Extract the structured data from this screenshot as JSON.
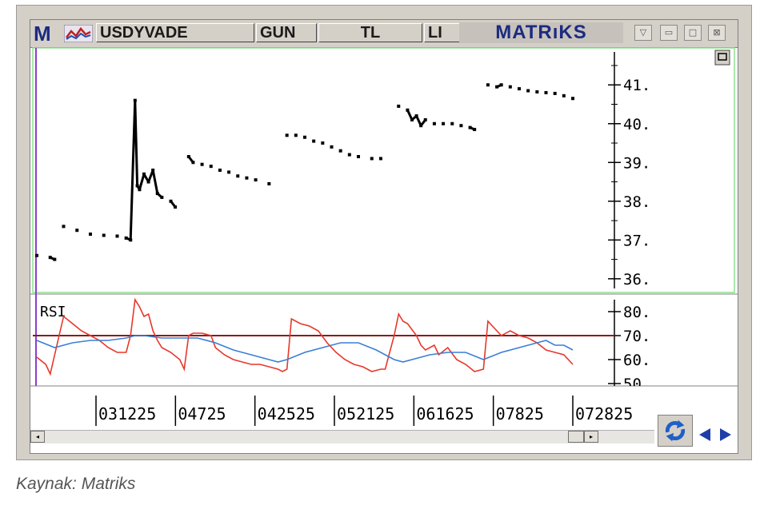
{
  "window": {
    "logo_letter": "M",
    "tabs": [
      "USDYVADE",
      "GUN",
      "TL",
      "LI"
    ],
    "brand": "MATRıKS",
    "controls": [
      "dropdown-icon",
      "minimize-icon",
      "maximize-icon",
      "close-icon"
    ]
  },
  "caption": "Kaynak: Matriks",
  "colors": {
    "price": "#000000",
    "rsi_red": "#e8372a",
    "rsi_blue": "#3a7fd5",
    "rsi_level": "#8b1a1a",
    "panel_border": "#90e090",
    "cursor_line": "#8a3fd0"
  },
  "chart_data": [
    {
      "type": "line",
      "title": "",
      "yticks": [
        "36.",
        "37.",
        "38.",
        "39.",
        "40.",
        "41."
      ],
      "ylim": [
        35.75,
        41.85
      ],
      "xlabels": [
        "031225",
        "04725",
        "042525",
        "052125",
        "061625",
        "07825",
        "072825"
      ],
      "series": [
        {
          "values": [
            [
              0,
              36.6
            ],
            [
              3,
              36.55
            ],
            [
              4,
              36.5
            ],
            [
              6,
              37.35
            ],
            [
              9,
              37.25
            ],
            [
              12,
              37.15
            ],
            [
              15,
              37.12
            ],
            [
              18,
              37.1
            ],
            [
              20,
              37.05
            ],
            [
              21,
              37.0
            ],
            [
              22,
              40.6
            ],
            [
              22.5,
              38.4
            ],
            [
              23,
              38.3
            ],
            [
              24,
              38.7
            ],
            [
              25,
              38.5
            ],
            [
              26,
              38.8
            ],
            [
              27,
              38.2
            ],
            [
              28,
              38.1
            ],
            [
              30,
              38.0
            ],
            [
              31,
              37.85
            ],
            [
              34,
              39.15
            ],
            [
              35,
              39.0
            ],
            [
              37,
              38.95
            ],
            [
              39,
              38.9
            ],
            [
              41,
              38.8
            ],
            [
              43,
              38.75
            ],
            [
              45,
              38.65
            ],
            [
              47,
              38.6
            ],
            [
              49,
              38.55
            ],
            [
              52,
              38.45
            ],
            [
              56,
              39.7
            ],
            [
              58,
              39.7
            ],
            [
              60,
              39.65
            ],
            [
              62,
              39.55
            ],
            [
              64,
              39.5
            ],
            [
              66,
              39.4
            ],
            [
              68,
              39.3
            ],
            [
              70,
              39.2
            ],
            [
              72,
              39.15
            ],
            [
              75,
              39.1
            ],
            [
              77,
              39.1
            ],
            [
              81,
              40.45
            ],
            [
              83,
              40.35
            ],
            [
              84,
              40.1
            ],
            [
              85,
              40.2
            ],
            [
              86,
              39.95
            ],
            [
              87,
              40.1
            ],
            [
              89,
              40.0
            ],
            [
              91,
              40.0
            ],
            [
              93,
              40.0
            ],
            [
              95,
              39.95
            ],
            [
              97,
              39.9
            ],
            [
              98,
              39.85
            ],
            [
              101,
              41.0
            ],
            [
              103,
              40.95
            ],
            [
              104,
              41.0
            ],
            [
              106,
              40.95
            ],
            [
              108,
              40.9
            ],
            [
              110,
              40.85
            ],
            [
              112,
              40.82
            ],
            [
              114,
              40.8
            ],
            [
              116,
              40.78
            ],
            [
              118,
              40.72
            ],
            [
              120,
              40.65
            ]
          ]
        }
      ]
    },
    {
      "type": "line",
      "title": "RSI",
      "yticks": [
        "50",
        "60.",
        "70.",
        "80."
      ],
      "ylim": [
        49,
        85
      ],
      "hline": 70,
      "series": [
        {
          "color": "red",
          "values": [
            [
              0,
              61
            ],
            [
              2,
              58
            ],
            [
              3,
              54
            ],
            [
              5,
              70
            ],
            [
              6,
              78
            ],
            [
              8,
              75
            ],
            [
              10,
              72
            ],
            [
              12,
              70
            ],
            [
              14,
              68
            ],
            [
              16,
              65
            ],
            [
              18,
              63
            ],
            [
              20,
              63
            ],
            [
              21,
              70
            ],
            [
              22,
              85
            ],
            [
              23,
              82
            ],
            [
              24,
              78
            ],
            [
              25,
              79
            ],
            [
              26,
              72
            ],
            [
              27,
              68
            ],
            [
              28,
              65
            ],
            [
              30,
              63
            ],
            [
              32,
              60
            ],
            [
              33,
              56
            ],
            [
              34,
              70
            ],
            [
              35,
              71
            ],
            [
              37,
              71
            ],
            [
              39,
              70
            ],
            [
              40,
              65
            ],
            [
              42,
              62
            ],
            [
              44,
              60
            ],
            [
              46,
              59
            ],
            [
              48,
              58
            ],
            [
              50,
              58
            ],
            [
              52,
              57
            ],
            [
              54,
              56
            ],
            [
              55,
              55
            ],
            [
              56,
              56
            ],
            [
              57,
              77
            ],
            [
              59,
              75
            ],
            [
              61,
              74
            ],
            [
              63,
              72
            ],
            [
              65,
              67
            ],
            [
              67,
              63
            ],
            [
              69,
              60
            ],
            [
              71,
              58
            ],
            [
              73,
              57
            ],
            [
              75,
              55
            ],
            [
              77,
              56
            ],
            [
              78,
              56
            ],
            [
              80,
              70
            ],
            [
              81,
              79
            ],
            [
              82,
              76
            ],
            [
              83,
              75
            ],
            [
              85,
              70
            ],
            [
              86,
              66
            ],
            [
              87,
              64
            ],
            [
              89,
              66
            ],
            [
              90,
              62
            ],
            [
              92,
              65
            ],
            [
              94,
              60
            ],
            [
              96,
              58
            ],
            [
              98,
              55
            ],
            [
              100,
              56
            ],
            [
              101,
              76
            ],
            [
              103,
              72
            ],
            [
              104,
              70
            ],
            [
              106,
              72
            ],
            [
              108,
              70
            ],
            [
              110,
              69
            ],
            [
              112,
              67
            ],
            [
              114,
              64
            ],
            [
              116,
              63
            ],
            [
              118,
              62
            ],
            [
              120,
              58
            ]
          ]
        },
        {
          "color": "blue",
          "values": [
            [
              0,
              68
            ],
            [
              4,
              65
            ],
            [
              8,
              67
            ],
            [
              12,
              68
            ],
            [
              16,
              68
            ],
            [
              20,
              69
            ],
            [
              22,
              70
            ],
            [
              24,
              70
            ],
            [
              28,
              69
            ],
            [
              32,
              69
            ],
            [
              36,
              69
            ],
            [
              40,
              67
            ],
            [
              44,
              64
            ],
            [
              48,
              62
            ],
            [
              52,
              60
            ],
            [
              54,
              59
            ],
            [
              56,
              60
            ],
            [
              60,
              63
            ],
            [
              64,
              65
            ],
            [
              68,
              67
            ],
            [
              72,
              67
            ],
            [
              76,
              64
            ],
            [
              80,
              60
            ],
            [
              82,
              59
            ],
            [
              84,
              60
            ],
            [
              88,
              62
            ],
            [
              92,
              63
            ],
            [
              96,
              63
            ],
            [
              100,
              60
            ],
            [
              104,
              63
            ],
            [
              108,
              65
            ],
            [
              112,
              67
            ],
            [
              114,
              68
            ],
            [
              116,
              66
            ],
            [
              118,
              66
            ],
            [
              120,
              64
            ]
          ]
        }
      ]
    }
  ]
}
